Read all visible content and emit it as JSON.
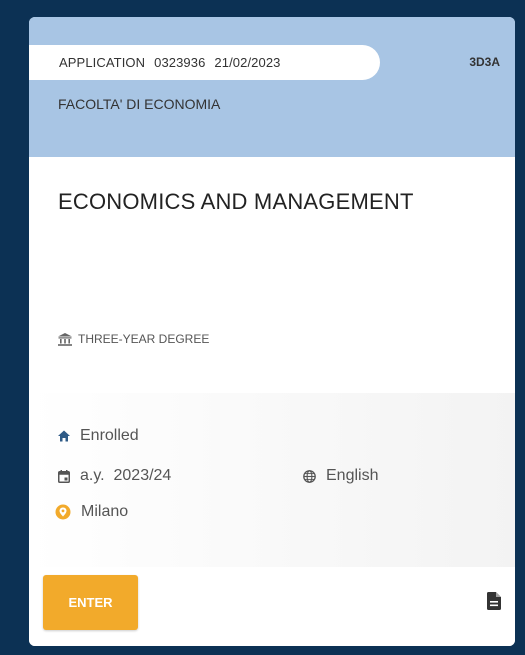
{
  "application": {
    "label": "APPLICATION",
    "number": "0323936",
    "date": "21/02/2023",
    "code": "3D3A"
  },
  "faculty": "FACOLTA' DI ECONOMIA",
  "course_title": "ECONOMICS AND MANAGEMENT",
  "degree_type": "THREE-YEAR DEGREE",
  "details": {
    "status": "Enrolled",
    "academic_year": "a.y.  2023/24",
    "language": "English",
    "location": "Milano"
  },
  "actions": {
    "enter_label": "ENTER"
  },
  "colors": {
    "page_background": "#0c3154",
    "header_background": "#a8c5e4",
    "accent": "#f2aa2b"
  }
}
